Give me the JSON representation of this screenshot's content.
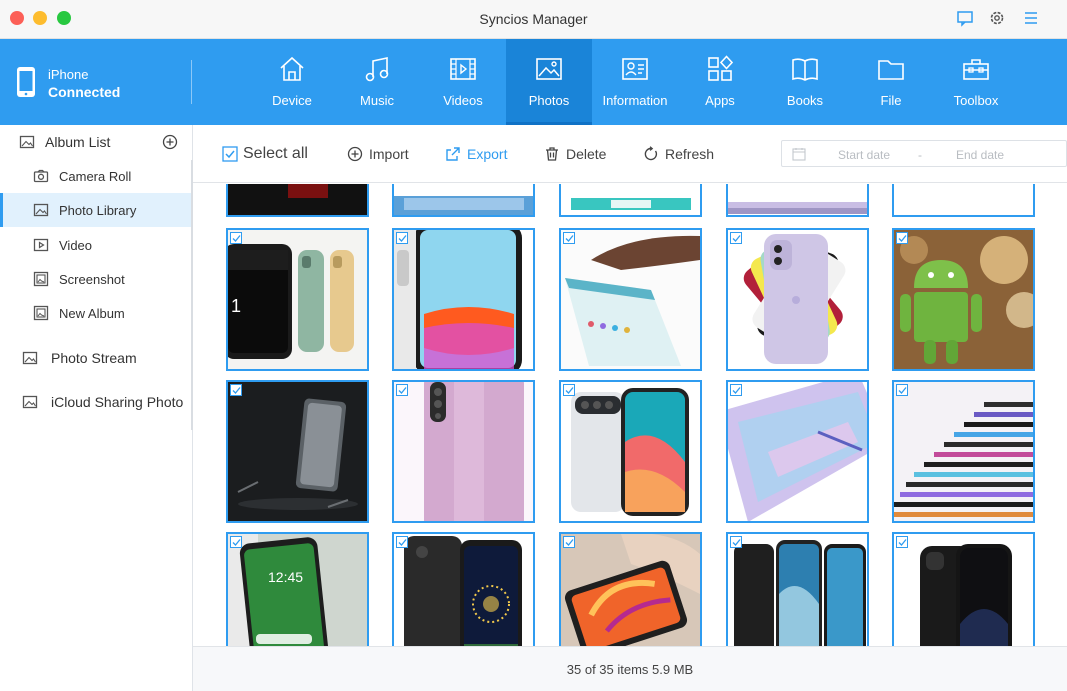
{
  "window": {
    "title": "Syncios Manager"
  },
  "device": {
    "name": "iPhone",
    "status": "Connected"
  },
  "nav": [
    {
      "label": "Device",
      "icon": "home-icon"
    },
    {
      "label": "Music",
      "icon": "music-icon"
    },
    {
      "label": "Videos",
      "icon": "video-icon"
    },
    {
      "label": "Photos",
      "icon": "photo-icon",
      "active": true
    },
    {
      "label": "Information",
      "icon": "contact-card-icon"
    },
    {
      "label": "Apps",
      "icon": "apps-icon"
    },
    {
      "label": "Books",
      "icon": "book-icon"
    },
    {
      "label": "File",
      "icon": "folder-icon"
    },
    {
      "label": "Toolbox",
      "icon": "toolbox-icon"
    }
  ],
  "sidebar": {
    "header": "Album List",
    "albums": [
      {
        "label": "Camera Roll",
        "icon": "camera-icon"
      },
      {
        "label": "Photo Library",
        "icon": "image-icon",
        "active": true
      },
      {
        "label": "Video",
        "icon": "play-icon"
      },
      {
        "label": "Screenshot",
        "icon": "screenshot-icon"
      },
      {
        "label": "New Album",
        "icon": "album-icon"
      }
    ],
    "sections": [
      {
        "label": "Photo Stream",
        "icon": "photo-stream-icon"
      },
      {
        "label": "iCloud Sharing Photo",
        "icon": "icloud-photo-icon"
      }
    ]
  },
  "toolbar": {
    "select_all": "Select all",
    "import": "Import",
    "export": "Export",
    "delete": "Delete",
    "refresh": "Refresh",
    "start_date": "Start date",
    "date_separator": "-",
    "end_date": "End date"
  },
  "footer": {
    "status": "35 of 35 items 5.9 MB"
  },
  "colors": {
    "accent": "#2f9cf0",
    "nav_active": "#1a84d8",
    "sidebar_active": "#e1f1fd"
  }
}
